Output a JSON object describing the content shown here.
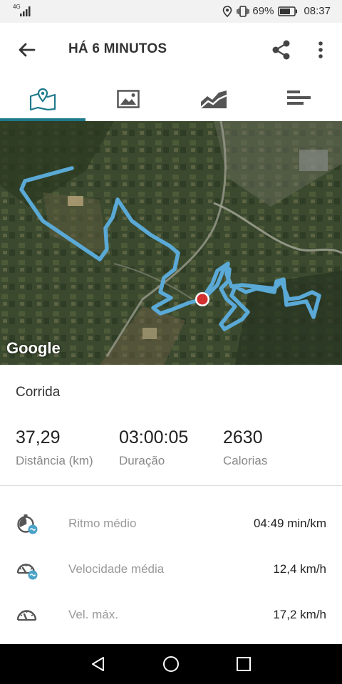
{
  "status_bar": {
    "network": "4G",
    "battery": "69%",
    "time": "08:37"
  },
  "app_bar": {
    "title": "HÁ 6 MINUTOS"
  },
  "tabs": [
    {
      "name": "map",
      "icon": "map-icon",
      "active": true
    },
    {
      "name": "photos",
      "icon": "image-icon",
      "active": false
    },
    {
      "name": "charts",
      "icon": "area-chart-icon",
      "active": false
    },
    {
      "name": "laps",
      "icon": "bars-icon",
      "active": false
    }
  ],
  "map": {
    "attribution": "Google",
    "route_color": "#5aa9d6",
    "marker_color": "#d32f2f"
  },
  "activity": {
    "type": "Corrida"
  },
  "stats": [
    {
      "value": "37,29",
      "label": "Distância (km)"
    },
    {
      "value": "03:00:05",
      "label": "Duração"
    },
    {
      "value": "2630",
      "label": "Calorias"
    }
  ],
  "details": [
    {
      "icon": "pace-timer-icon",
      "label": "Ritmo médio",
      "value": "04:49 min/km"
    },
    {
      "icon": "speedometer-icon",
      "label": "Velocidade média",
      "value": "12,4 km/h"
    },
    {
      "icon": "max-speed-icon",
      "label": "Vel. máx.",
      "value": "17,2 km/h"
    }
  ],
  "colors": {
    "accent": "#1e7a8c",
    "icon_badge": "#4aa3c8"
  }
}
